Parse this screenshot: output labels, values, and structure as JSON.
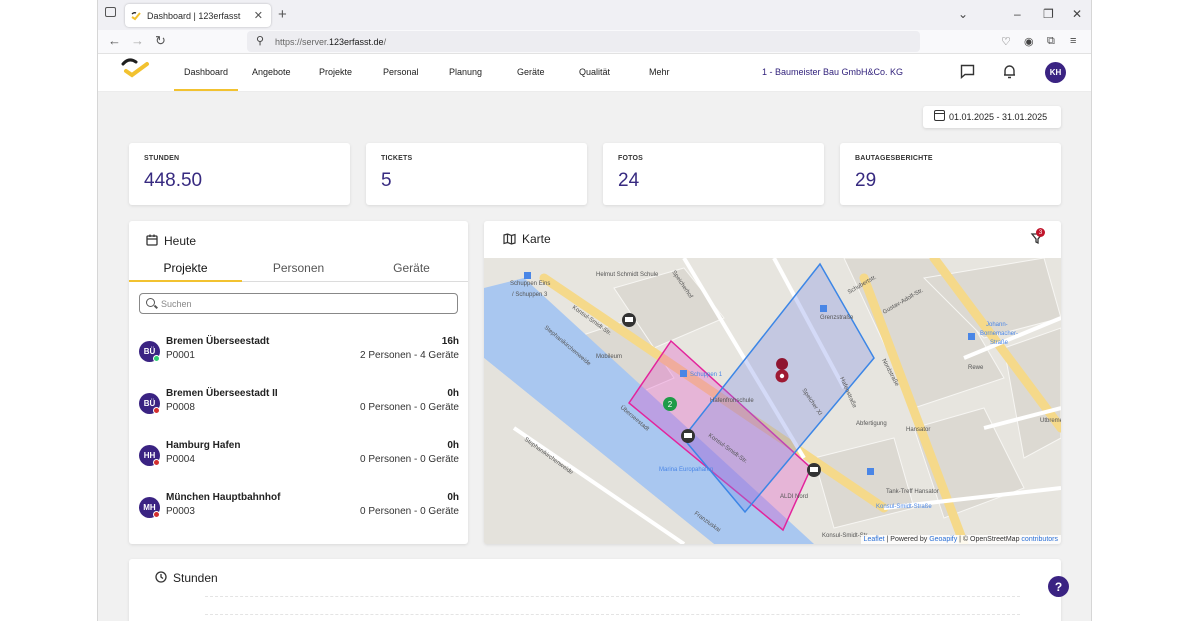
{
  "browser": {
    "tab_title": "Dashboard | 123erfasst",
    "url_prefix": "https://server.",
    "url_domain": "123erfasst.de",
    "url_suffix": "/"
  },
  "nav": {
    "items": [
      "Dashboard",
      "Angebote",
      "Projekte",
      "Personal",
      "Planung",
      "Geräte",
      "Qualität",
      "Mehr"
    ],
    "company": "1 - Baumeister Bau GmbH&Co. KG",
    "user_initials": "KH"
  },
  "date_range": "01.01.2025 - 31.01.2025",
  "stats": [
    {
      "label": "STUNDEN",
      "value": "448.50"
    },
    {
      "label": "TICKETS",
      "value": "5"
    },
    {
      "label": "FOTOS",
      "value": "24"
    },
    {
      "label": "BAUTAGESBERICHTE",
      "value": "29"
    }
  ],
  "heute": {
    "title": "Heute",
    "tabs": [
      "Projekte",
      "Personen",
      "Geräte"
    ],
    "search_placeholder": "Suchen",
    "projects": [
      {
        "initials": "BÜ",
        "name": "Bremen Überseestadt",
        "code": "P0001",
        "hours": "16h",
        "desc": "2 Personen - 4 Geräte",
        "status_color": "#2ecc71"
      },
      {
        "initials": "BÜ",
        "name": "Bremen Überseestadt II",
        "code": "P0008",
        "hours": "0h",
        "desc": "0 Personen - 0 Geräte",
        "status_color": "#d32f2f"
      },
      {
        "initials": "HH",
        "name": "Hamburg Hafen",
        "code": "P0004",
        "hours": "0h",
        "desc": "0 Personen - 0 Geräte",
        "status_color": "#d32f2f"
      },
      {
        "initials": "MH",
        "name": "München Hauptbahnhof",
        "code": "P0003",
        "hours": "0h",
        "desc": "0 Personen - 0 Geräte",
        "status_color": "#d32f2f"
      }
    ]
  },
  "karte": {
    "title": "Karte",
    "filter_badge": "3",
    "cluster_count": "2",
    "attribution": {
      "leaflet": "Leaflet",
      "mid": " | Powered by ",
      "geoapify": "Geoapify",
      "osm": " | © OpenStreetMap ",
      "contributors": "contributors"
    },
    "labels": [
      "Helmut Schmidt Schule",
      "Schuppen Eins",
      "/ Schuppen 3",
      "Konsul-Smidt-Str.",
      "Speicherhof",
      "Mobileum",
      "Schuppen 1",
      "Hafenfrohschule",
      "Grenzstraße",
      "Schuppen 2",
      "Johann-",
      "Bornemacher-",
      "Straße",
      "Rewe",
      "Abfertigung",
      "Hansator",
      "Tank-Treff Hansator",
      "Konsul-Smidt-Straße",
      "ALDI Nord",
      "Marina Europahafen",
      "Stephanikirchenweide",
      "Franziuskai",
      "Überseestadt",
      "Speicher XI",
      "Hafenstraße",
      "Nordstraße",
      "Gustav-Adolf-Str.",
      "Stephanikirchenweide",
      "Schubertstr.",
      "Utbremen",
      "Konsul-Smidt-Str."
    ]
  },
  "stunden": {
    "title": "Stunden"
  },
  "help_label": "?"
}
